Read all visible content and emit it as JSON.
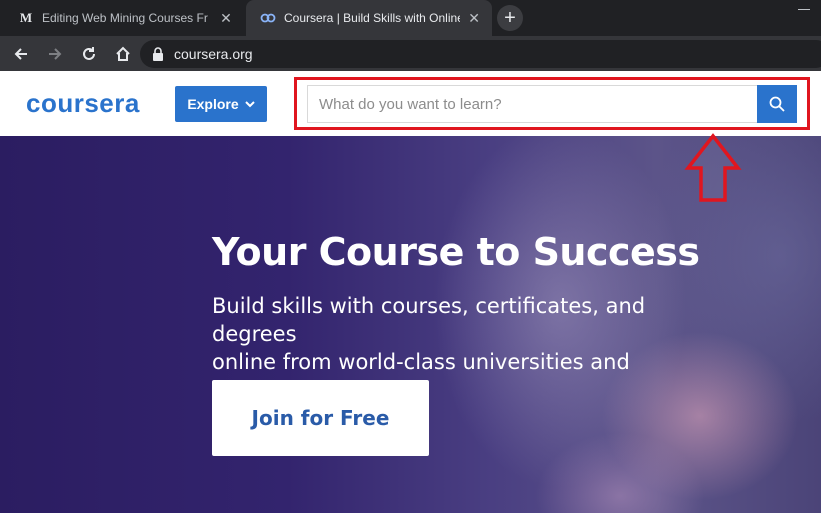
{
  "browser": {
    "tabs": [
      {
        "title": "Editing Web Mining Courses Fr",
        "favicon": "medium-m-icon",
        "active": false
      },
      {
        "title": "Coursera | Build Skills with Online",
        "favicon": "coursera-icon",
        "active": true
      }
    ],
    "url": "coursera.org"
  },
  "header": {
    "logo": "coursera",
    "explore_label": "Explore",
    "search": {
      "placeholder": "What do you want to learn?",
      "value": ""
    }
  },
  "hero": {
    "title": "Your Course to Success",
    "subtitle_line1": "Build skills with courses, certificates, and degrees",
    "subtitle_line2": "online from world-class universities and companies",
    "cta_label": "Join for Free"
  },
  "annotation": {
    "highlight_color": "#e0161f",
    "target": "search-bar"
  },
  "colors": {
    "brand_blue": "#2a73cc",
    "hero_purple": "#2b1d61"
  }
}
